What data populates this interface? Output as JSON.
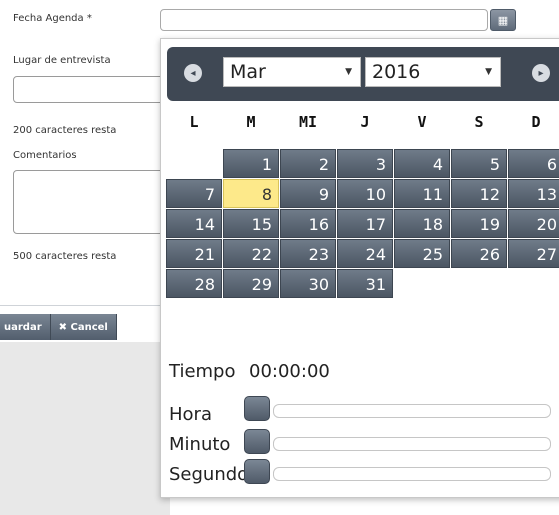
{
  "form": {
    "fecha_label": "Fecha Agenda *",
    "lugar_label": "Lugar de entrevista",
    "lugar_counter": "200 caracteres resta",
    "comentarios_label": "Comentarios",
    "comentarios_counter": "500 caracteres resta",
    "calendar_icon": "calendar-icon",
    "save_label": "uardar",
    "cancel_label": "✖ Cancel"
  },
  "picker": {
    "prev_icon": "prev-icon",
    "next_icon": "next-icon",
    "month": "Mar",
    "year": "2016",
    "weekdays": [
      "L",
      "M",
      "MI",
      "J",
      "V",
      "S",
      "D"
    ],
    "weeks": [
      [
        "",
        "1",
        "2",
        "3",
        "4",
        "5",
        "6"
      ],
      [
        "7",
        "8",
        "9",
        "10",
        "11",
        "12",
        "13"
      ],
      [
        "14",
        "15",
        "16",
        "17",
        "18",
        "19",
        "20"
      ],
      [
        "21",
        "22",
        "23",
        "24",
        "25",
        "26",
        "27"
      ],
      [
        "28",
        "29",
        "30",
        "31",
        "",
        "",
        ""
      ]
    ],
    "highlighted_day": "8",
    "time_label": "Tiempo",
    "time_value": "00:00:00",
    "hora_label": "Hora",
    "minuto_label": "Minuto",
    "segundo_label": "Segundo",
    "hora_value": 0,
    "minuto_value": 0,
    "segundo_value": 0
  },
  "colors": {
    "header_bg": "#3f4854",
    "day_bg": "#5d6876",
    "today_bg": "#fde98a"
  }
}
